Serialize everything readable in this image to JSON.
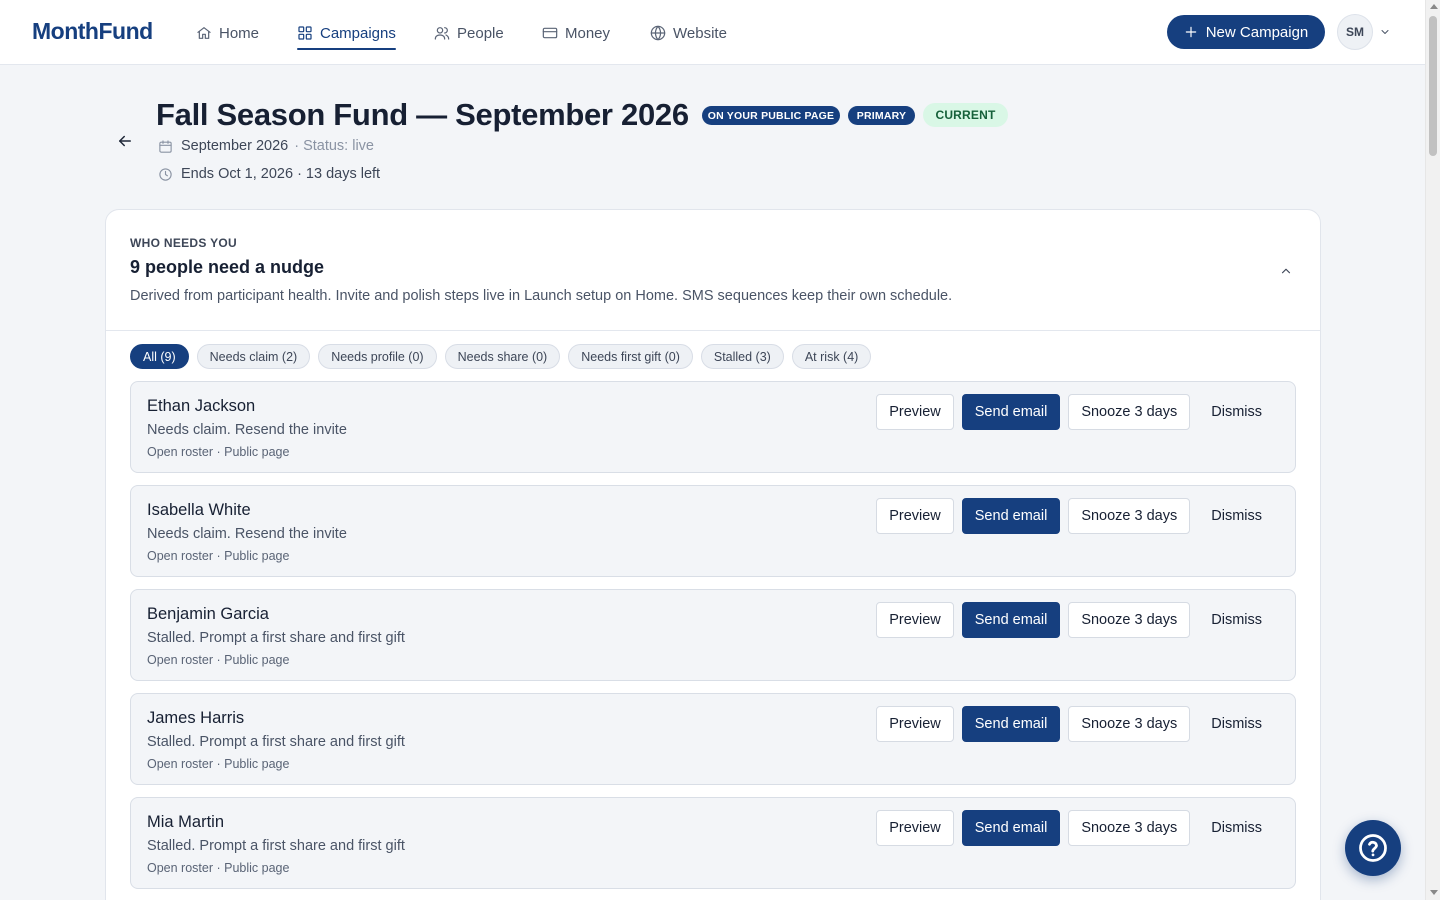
{
  "app": {
    "logo": "MonthFund"
  },
  "nav": {
    "items": [
      {
        "label": "Home",
        "icon": "home-icon"
      },
      {
        "label": "Campaigns",
        "icon": "grid-icon",
        "active": true
      },
      {
        "label": "People",
        "icon": "users-icon"
      },
      {
        "label": "Money",
        "icon": "card-icon"
      },
      {
        "label": "Website",
        "icon": "globe-icon"
      }
    ],
    "new_campaign_label": "New Campaign",
    "avatar_initials": "SM"
  },
  "campaign": {
    "title": "Fall Season Fund — September 2026",
    "badges": {
      "public": "ON YOUR PUBLIC PAGE",
      "primary": "PRIMARY",
      "current": "CURRENT"
    },
    "month": "September 2026",
    "status": "· Status: live",
    "ends": "Ends Oct 1, 2026 · 13 days left"
  },
  "nudge_panel": {
    "eyebrow": "WHO NEEDS YOU",
    "title": "9 people need a nudge",
    "description": "Derived from participant health. Invite and polish steps live in Launch setup on Home. SMS sequences keep their own schedule.",
    "filters": [
      {
        "label": "All (9)",
        "active": true
      },
      {
        "label": "Needs claim (2)"
      },
      {
        "label": "Needs profile (0)"
      },
      {
        "label": "Needs share (0)"
      },
      {
        "label": "Needs first gift (0)"
      },
      {
        "label": "Stalled (3)"
      },
      {
        "label": "At risk (4)"
      }
    ],
    "actions": {
      "preview": "Preview",
      "send_email": "Send email",
      "snooze": "Snooze 3 days",
      "dismiss": "Dismiss"
    },
    "people": [
      {
        "name": "Ethan Jackson",
        "reason": "Needs claim. Resend the invite",
        "sub": "Open roster · Public page"
      },
      {
        "name": "Isabella White",
        "reason": "Needs claim. Resend the invite",
        "sub": "Open roster · Public page"
      },
      {
        "name": "Benjamin Garcia",
        "reason": "Stalled. Prompt a first share and first gift",
        "sub": "Open roster · Public page"
      },
      {
        "name": "James Harris",
        "reason": "Stalled. Prompt a first share and first gift",
        "sub": "Open roster · Public page"
      },
      {
        "name": "Mia Martin",
        "reason": "Stalled. Prompt a first share and first gift",
        "sub": "Open roster · Public page"
      }
    ]
  },
  "colors": {
    "brand": "#163f7f",
    "page_bg": "#f3f5f8",
    "current_badge_bg": "#d9f7e6"
  }
}
